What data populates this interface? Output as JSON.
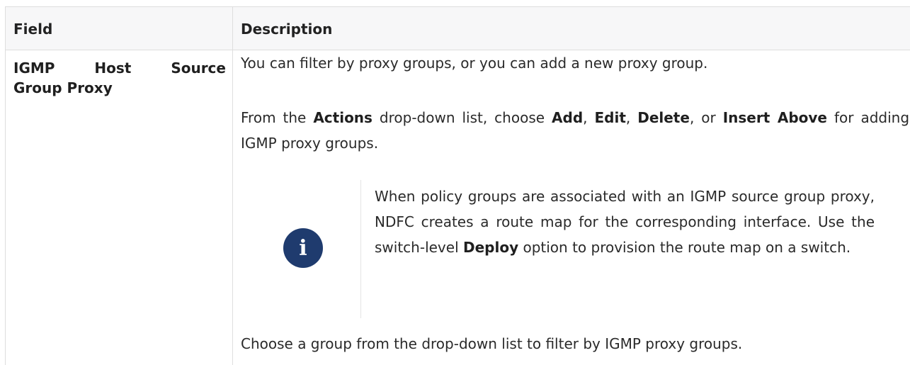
{
  "table": {
    "headers": [
      "Field",
      "Description"
    ]
  },
  "row": {
    "field_line1_word1": "IGMP",
    "field_line1_word2": "Host",
    "field_line1_word3": "Source",
    "field_line2": "Group Proxy",
    "p1": "You can filter by proxy groups, or you can add a new proxy group.",
    "p2_a": "From the ",
    "p2_actions": "Actions",
    "p2_b": " drop-down list, choose ",
    "p2_add": "Add",
    "p2_c": ", ",
    "p2_edit": "Edit",
    "p2_d": ", ",
    "p2_delete": "Delete",
    "p2_e": ", or ",
    "p2_insert_above": "Insert Above",
    "p2_f": " for adding IGMP proxy groups.",
    "note_icon": "info-icon",
    "note_a": "When policy groups are associated with an IGMP source group proxy, NDFC creates a route map for the corresponding interface. Use the switch-level ",
    "note_deploy": "Deploy",
    "note_b": " option to provision the route map on a switch.",
    "p3": "Choose a group from the drop-down list to filter by IGMP proxy groups."
  },
  "colors": {
    "header_bg": "#f7f7f8",
    "border": "#dedede",
    "note_icon_bg": "#1f3b6e"
  }
}
